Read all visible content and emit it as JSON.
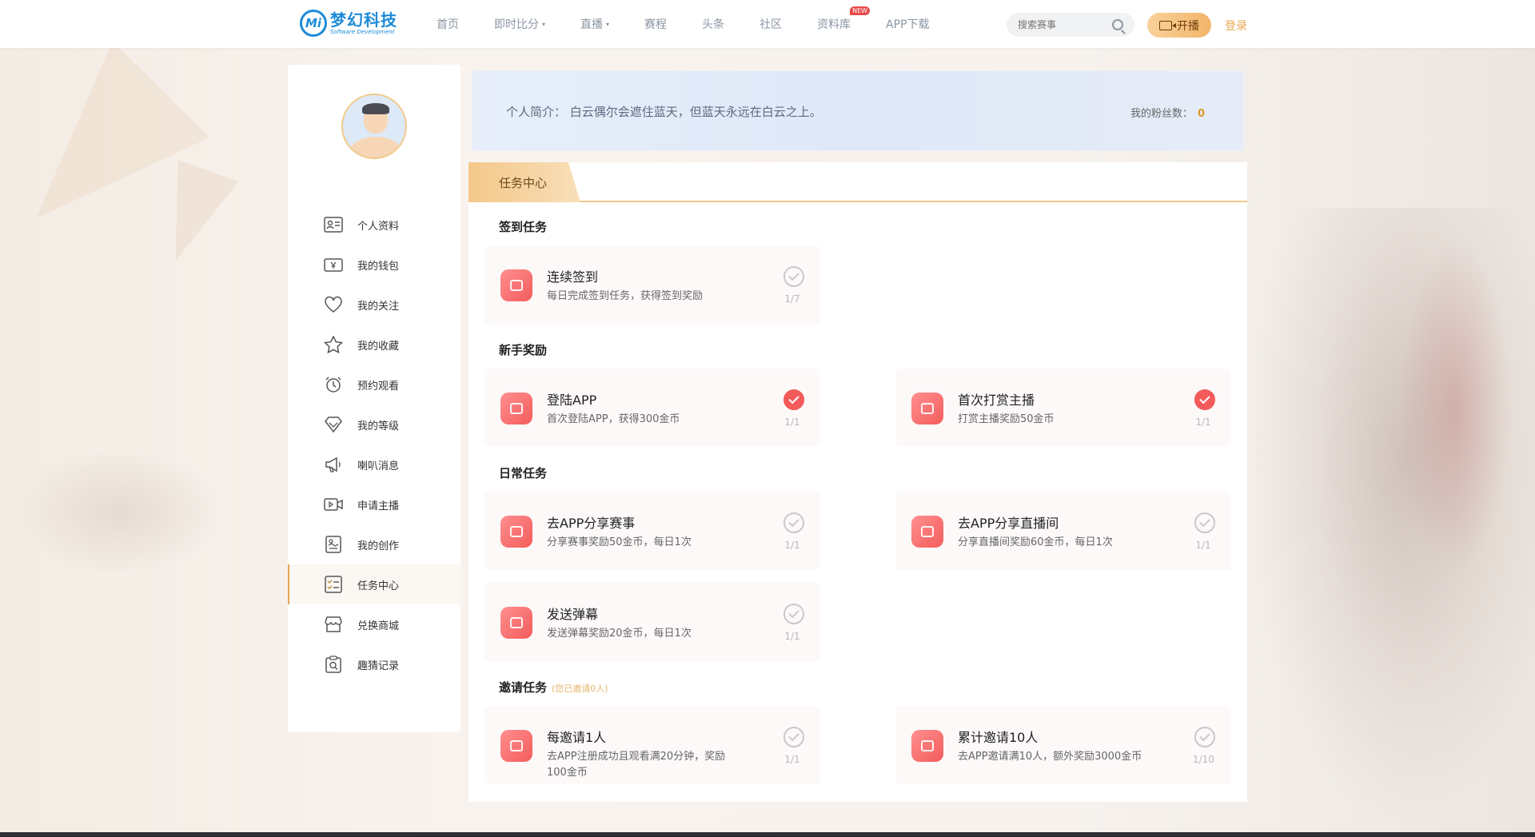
{
  "header": {
    "logo_cn": "梦幻科技",
    "logo_en": "Software Development",
    "logo_mark": "Mi",
    "nav": [
      {
        "label": "首页"
      },
      {
        "label": "即时比分",
        "caret": "▾"
      },
      {
        "label": "直播",
        "caret": "▾"
      },
      {
        "label": "赛程"
      },
      {
        "label": "头条"
      },
      {
        "label": "社区"
      },
      {
        "label": "资料库",
        "badge": "NEW"
      },
      {
        "label": "APP下载"
      }
    ],
    "search_placeholder": "搜索赛事",
    "live_button": "开播",
    "login": "登录"
  },
  "sidebar": {
    "items": [
      {
        "label": "个人资料",
        "icon": "id-card-icon"
      },
      {
        "label": "我的钱包",
        "icon": "wallet-icon"
      },
      {
        "label": "我的关注",
        "icon": "heart-icon"
      },
      {
        "label": "我的收藏",
        "icon": "star-icon"
      },
      {
        "label": "预约观看",
        "icon": "alarm-clock-icon"
      },
      {
        "label": "我的等级",
        "icon": "diamond-icon"
      },
      {
        "label": "喇叭消息",
        "icon": "megaphone-icon"
      },
      {
        "label": "申请主播",
        "icon": "video-icon"
      },
      {
        "label": "我的创作",
        "icon": "document-icon"
      },
      {
        "label": "任务中心",
        "icon": "checklist-icon",
        "active": true
      },
      {
        "label": "兑换商城",
        "icon": "shop-icon"
      },
      {
        "label": "趣猜记录",
        "icon": "clipboard-search-icon"
      }
    ]
  },
  "profile": {
    "bio": "个人简介： 白云偶尔会遮住蓝天，但蓝天永远在白云之上。",
    "fans_label": "我的粉丝数：",
    "fans_count": "0"
  },
  "task_center": {
    "tab": "任务中心",
    "sections": {
      "signin": {
        "title": "签到任务"
      },
      "newbie": {
        "title": "新手奖励"
      },
      "daily": {
        "title": "日常任务"
      },
      "invite": {
        "title": "邀请任务",
        "hint": "(您已邀请0人)"
      }
    },
    "tasks": {
      "signin_continuous": {
        "name": "连续签到",
        "desc": "每日完成签到任务，获得签到奖励",
        "progress": "1/7",
        "done": false
      },
      "login_app": {
        "name": "登陆APP",
        "desc": "首次登陆APP，获得300金币",
        "progress": "1/1",
        "done": true
      },
      "first_tip": {
        "name": "首次打赏主播",
        "desc": "打赏主播奖励50金币",
        "progress": "1/1",
        "done": true
      },
      "share_match": {
        "name": "去APP分享赛事",
        "desc": "分享赛事奖励50金币，每日1次",
        "progress": "1/1",
        "done": false
      },
      "share_live": {
        "name": "去APP分享直播间",
        "desc": "分享直播间奖励60金币，每日1次",
        "progress": "1/1",
        "done": false
      },
      "send_danmaku": {
        "name": "发送弹幕",
        "desc": "发送弹幕奖励20金币，每日1次",
        "progress": "1/1",
        "done": false
      },
      "invite_one": {
        "name": "每邀请1人",
        "desc": "去APP注册成功且观看满20分钟，奖励100金币",
        "progress": "1/1",
        "done": false
      },
      "invite_ten": {
        "name": "累计邀请10人",
        "desc": "去APP邀请满10人，额外奖励3000金币",
        "progress": "1/10",
        "done": false
      }
    }
  },
  "colors": {
    "brand_blue": "#1d8bd8",
    "accent_gold": "#e4a654",
    "task_red": "#f35a5a"
  }
}
